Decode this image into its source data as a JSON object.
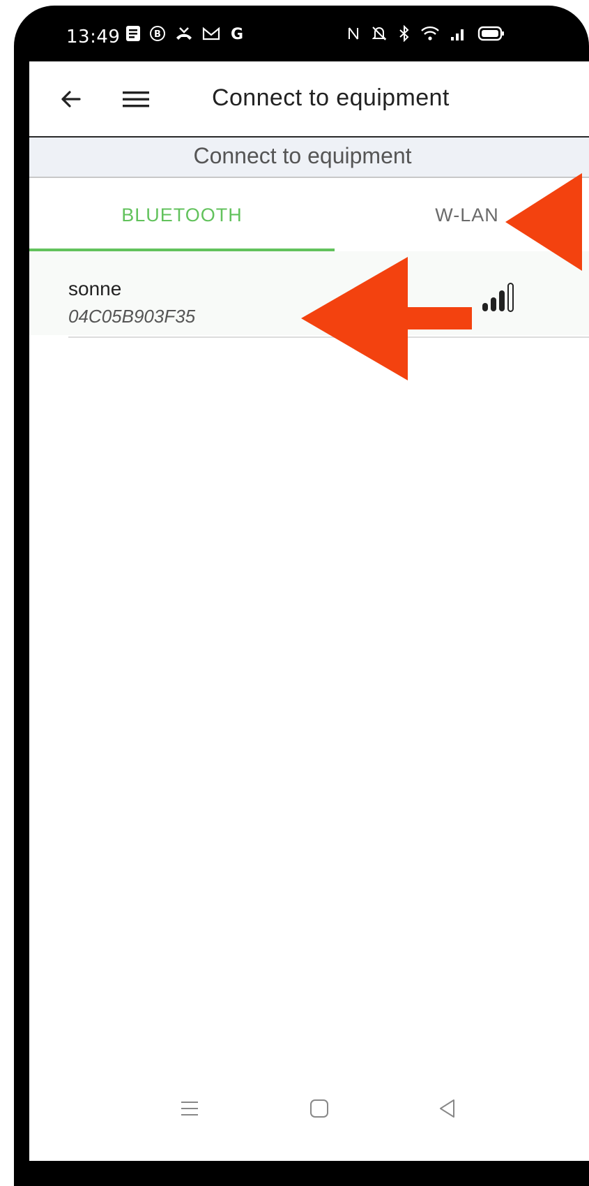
{
  "status_bar": {
    "time": "13:49",
    "left_icons": [
      "notes-icon",
      "b-badge-icon",
      "missed-call-icon",
      "gmail-icon",
      "google-icon"
    ],
    "right_icons": [
      "nfc-icon",
      "silent-icon",
      "bluetooth-icon",
      "wifi-icon",
      "signal-icon",
      "battery-icon"
    ]
  },
  "appbar": {
    "title": "Connect to equipment",
    "back_icon": "back-arrow-icon",
    "menu_icon": "hamburger-menu-icon"
  },
  "subheader": {
    "title": "Connect to equipment"
  },
  "tabs": [
    {
      "label": "BLUETOOTH",
      "active": true
    },
    {
      "label": "W-LAN",
      "active": false
    }
  ],
  "devices": [
    {
      "name": "sonne",
      "id": "04C05B903F35",
      "signal_icon": "signal-strength-icon",
      "signal_level": 0.75
    }
  ],
  "nav_bar": {
    "icons": [
      "recent-apps-icon",
      "home-icon",
      "back-triangle-icon"
    ]
  },
  "colors": {
    "accent": "#62c25c",
    "annotation_arrow": "#f3420f",
    "frame": "#000000",
    "subheader_bg": "#eef1f6"
  }
}
